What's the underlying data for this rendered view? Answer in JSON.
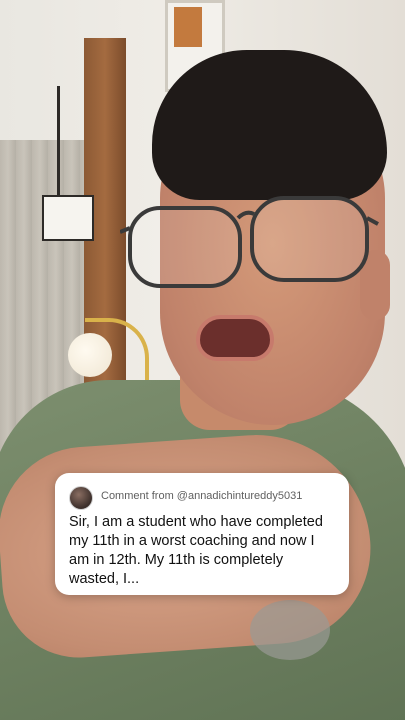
{
  "comment": {
    "from_text": "Comment from @annadichintureddy5031",
    "body": "Sir, I am a student who have completed my 11th in a worst coaching and now I am in 12th. My 11th is completely wasted, I...",
    "avatar_icon": "user-avatar-icon"
  },
  "colors": {
    "card_bg": "#ffffff",
    "card_text": "#111111",
    "card_meta_text": "#606060",
    "shirt": "#6d8060"
  }
}
